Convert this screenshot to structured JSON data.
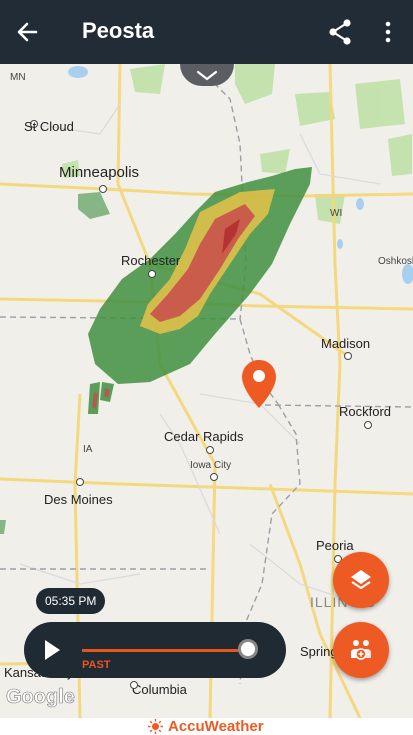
{
  "app_bar": {
    "title": "Peosta",
    "back_icon": "arrow-left-icon",
    "share_icon": "share-icon",
    "more_icon": "more-vert-icon"
  },
  "map": {
    "cities": [
      {
        "name": "St Cloud"
      },
      {
        "name": "Minneapolis"
      },
      {
        "name": "Rochester"
      },
      {
        "name": "Madison"
      },
      {
        "name": "Rockford"
      },
      {
        "name": "Cedar Rapids"
      },
      {
        "name": "Iowa City"
      },
      {
        "name": "Des Moines"
      },
      {
        "name": "Peoria"
      },
      {
        "name": "Springfield"
      },
      {
        "name": "Columbia"
      },
      {
        "name": "Oshkosh"
      },
      {
        "name": "Kansas City"
      }
    ],
    "state_labels": [
      "MN",
      "WI",
      "IA",
      "ILLINOIS"
    ],
    "location_pin_icon": "location-pin-icon"
  },
  "timeline": {
    "time": "05:35 PM",
    "mode": "PAST",
    "progress": 0.93,
    "play_icon": "play-icon"
  },
  "fabs": {
    "layers_icon": "layers-icon",
    "community_icon": "people-add-icon"
  },
  "attribution": "Google",
  "brand": "AccuWeather",
  "colors": {
    "app_bar": "#212c36",
    "accent": "#ee5a24",
    "radar_green": "#3f8f3f",
    "radar_yellow": "#e6c24a",
    "radar_red": "#c84b4b"
  }
}
